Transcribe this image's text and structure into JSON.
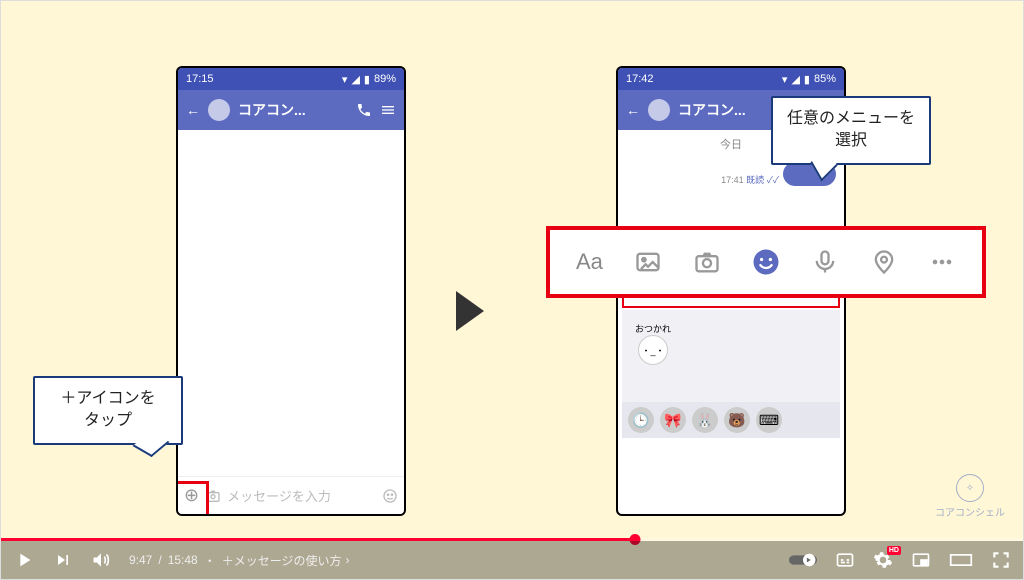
{
  "callouts": {
    "left": "＋アイコンを\nタップ",
    "right": "任意のメニューを\n選択"
  },
  "phone_left": {
    "time": "17:15",
    "battery": "89%",
    "title": "コアコン...",
    "placeholder": "メッセージを入力"
  },
  "phone_right": {
    "time": "17:42",
    "battery": "85%",
    "title": "コアコン...",
    "date": "今日",
    "msg_time": "17:41",
    "read": "既読",
    "sticker_label": "おつかれ"
  },
  "menu": {
    "aa": "Aa"
  },
  "watermark": "コアコンシェル",
  "player": {
    "current": "9:47",
    "total": "15:48",
    "chapter": "＋メッセージの使い方",
    "hd": "HD"
  }
}
